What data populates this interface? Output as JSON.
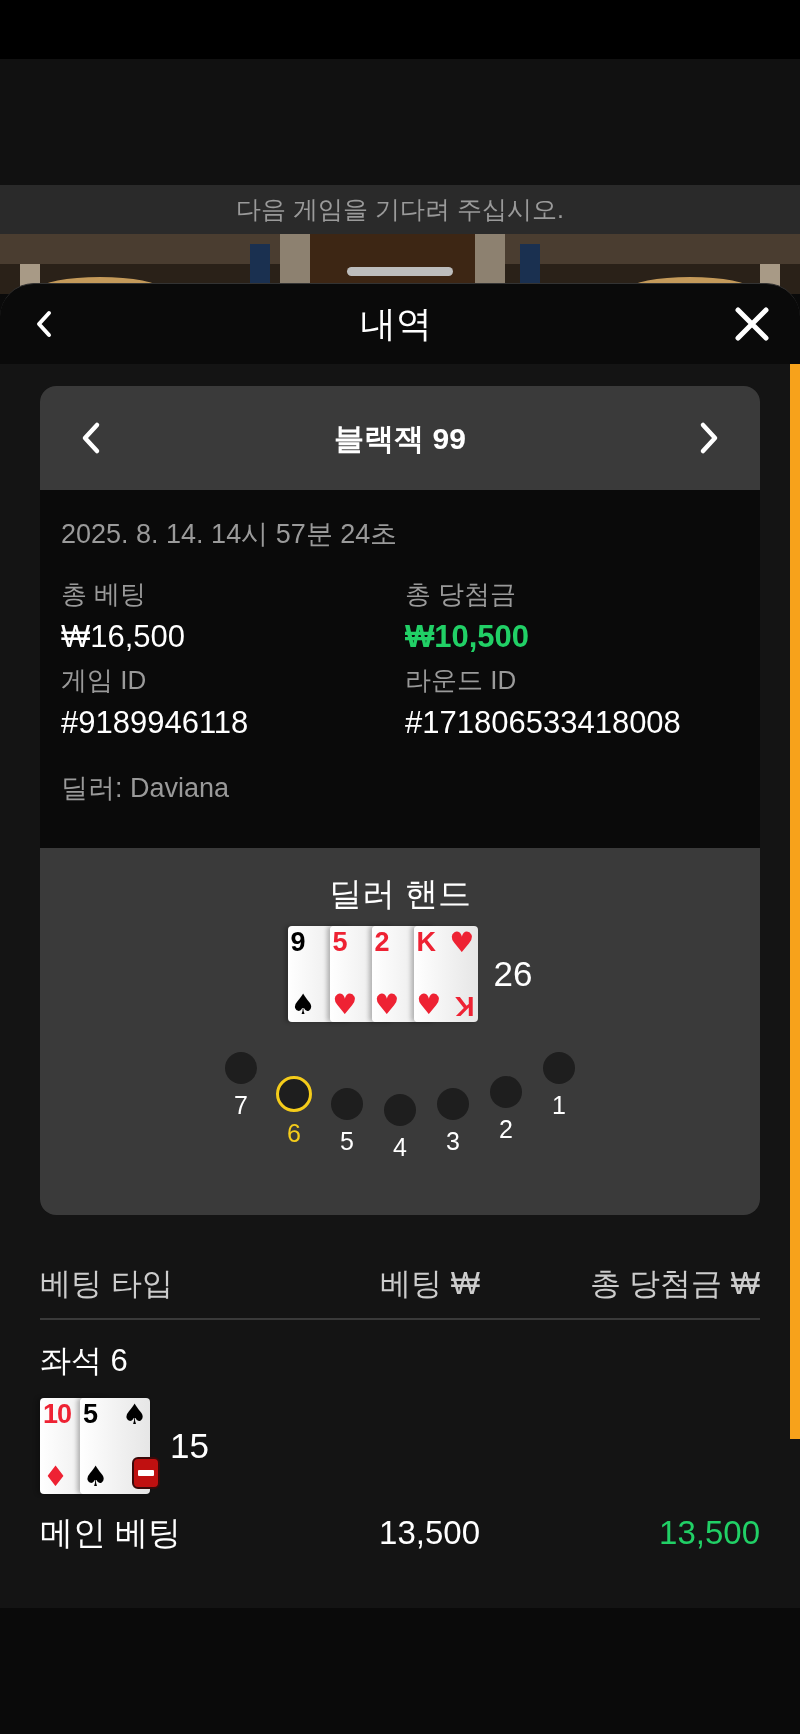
{
  "banner": {
    "message": "다음 게임을 기다려 주십시오."
  },
  "header": {
    "title": "내역"
  },
  "game": {
    "title": "블랙잭 99",
    "datetime": "2025. 8. 14. 14시 57분 24초",
    "fields": [
      {
        "label": "총 베팅",
        "value": "₩16,500",
        "highlight": false
      },
      {
        "label": "총 당첨금",
        "value": "₩10,500",
        "highlight": true
      },
      {
        "label": "게임 ID",
        "value": "#9189946118",
        "highlight": false
      },
      {
        "label": "라운드 ID",
        "value": "#171806533418008",
        "highlight": false
      }
    ],
    "dealer_name": "딜러: Daviana"
  },
  "dealer_hand": {
    "title": "딜러 핸드",
    "total": "26",
    "cards": [
      {
        "rank": "9",
        "suit": "♠",
        "color": "#000000"
      },
      {
        "rank": "5",
        "suit": "♥",
        "color": "#ee2233"
      },
      {
        "rank": "2",
        "suit": "♥",
        "color": "#ee2233"
      },
      {
        "rank": "K",
        "suit": "♥",
        "color": "#ee2233",
        "suit_2": "♥",
        "rank_2": "K"
      }
    ]
  },
  "seats": [
    {
      "label": "7",
      "selected": false
    },
    {
      "label": "6",
      "selected": true
    },
    {
      "label": "5",
      "selected": false
    },
    {
      "label": "4",
      "selected": false
    },
    {
      "label": "3",
      "selected": false
    },
    {
      "label": "2",
      "selected": false
    },
    {
      "label": "1",
      "selected": false
    }
  ],
  "bets": {
    "columns": [
      "베팅 타입",
      "베팅 ₩",
      "총 당첨금 ₩"
    ],
    "seat_title": "좌석 6",
    "hand": {
      "total": "15",
      "minus_badge": true,
      "cards": [
        {
          "rank": "10",
          "suit": "♦",
          "color": "#ee2233"
        },
        {
          "rank": "5",
          "suit": "♠",
          "color": "#000000",
          "suit_2": "♠"
        }
      ]
    },
    "rows": [
      {
        "type": "메인 베팅",
        "bet": "13,500",
        "win": "13,500"
      }
    ]
  }
}
